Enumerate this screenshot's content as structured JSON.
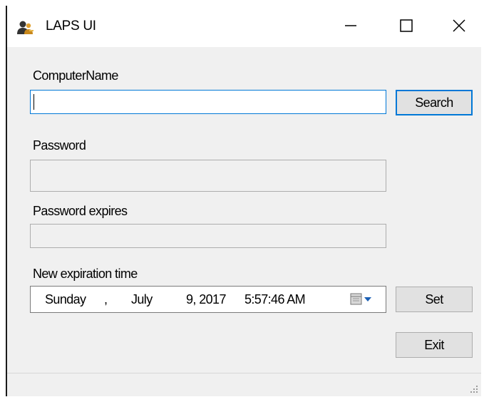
{
  "window": {
    "title": "LAPS UI",
    "app_icon": "users-key-icon"
  },
  "titlebar": {
    "minimize_icon": "minimize-icon",
    "maximize_icon": "maximize-icon",
    "close_icon": "close-icon"
  },
  "form": {
    "computer_name_label": "ComputerName",
    "computer_name_value": "",
    "search_label": "Search",
    "password_label": "Password",
    "password_value": "",
    "password_expires_label": "Password expires",
    "password_expires_value": "",
    "new_expiration_label": "New expiration time",
    "expiration": {
      "day": "Sunday",
      "sep": ",",
      "month": "July",
      "date": "9, 2017",
      "time": "5:57:46 AM"
    },
    "calendar_icon": "calendar-dropdown-icon",
    "set_label": "Set",
    "exit_label": "Exit"
  },
  "colors": {
    "focus": "#0078d7",
    "background": "#f0f0f0"
  }
}
